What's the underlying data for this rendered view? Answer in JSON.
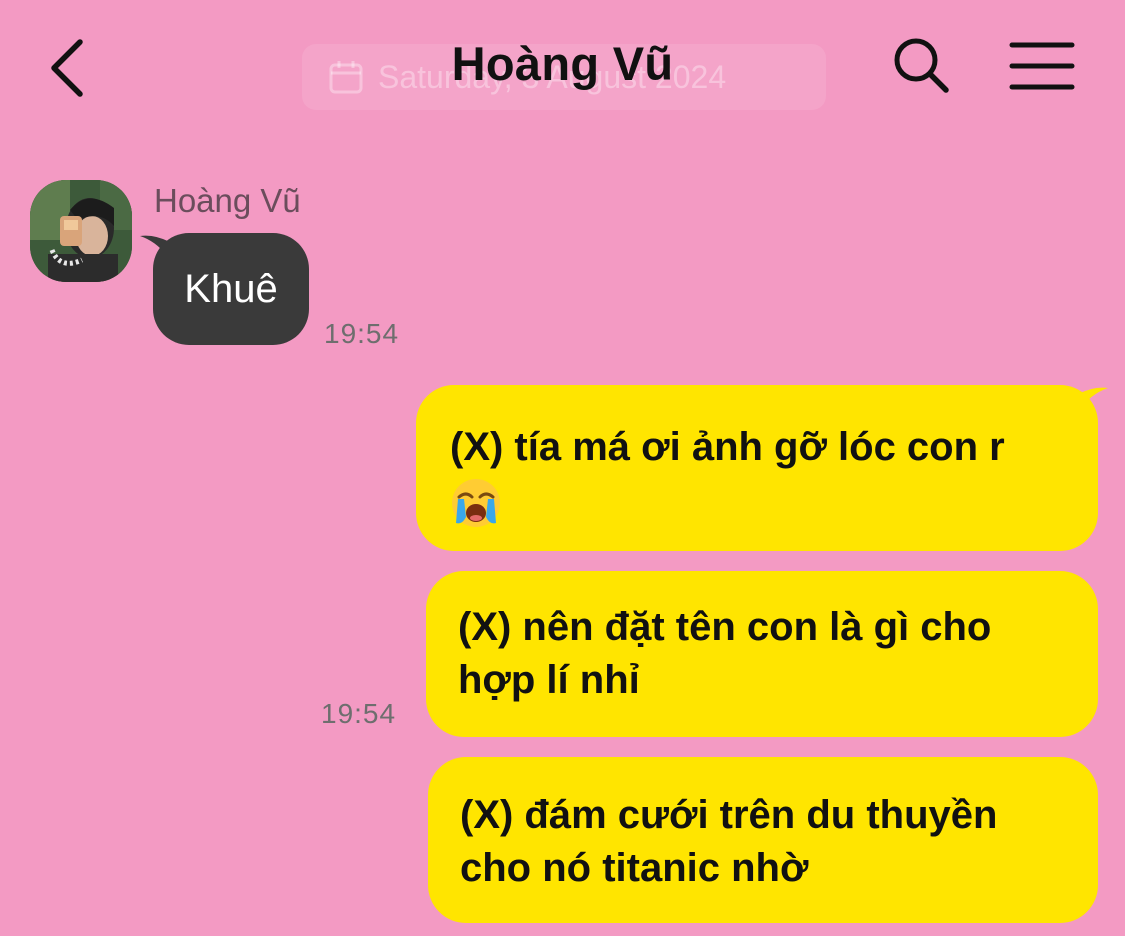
{
  "header": {
    "title": "Hoàng Vũ",
    "date_chip": "Saturday, 3 August 2024"
  },
  "incoming": {
    "sender": "Hoàng Vũ",
    "text": "Khuê",
    "time": "19:54"
  },
  "outgoing": [
    {
      "text": "(X) tía má ơi ảnh gỡ lóc con r",
      "emoji": "loudly-crying-face"
    },
    {
      "text": "(X) nên đặt tên con là gì cho hợp lí nhỉ"
    },
    {
      "text": "(X) đám cưới trên du thuyền cho nó titanic nhờ"
    }
  ],
  "outgoing_time": "19:54",
  "colors": {
    "background": "#f39ac3",
    "incoming_bubble": "#3a3a3a",
    "outgoing_bubble": "#ffe500"
  }
}
